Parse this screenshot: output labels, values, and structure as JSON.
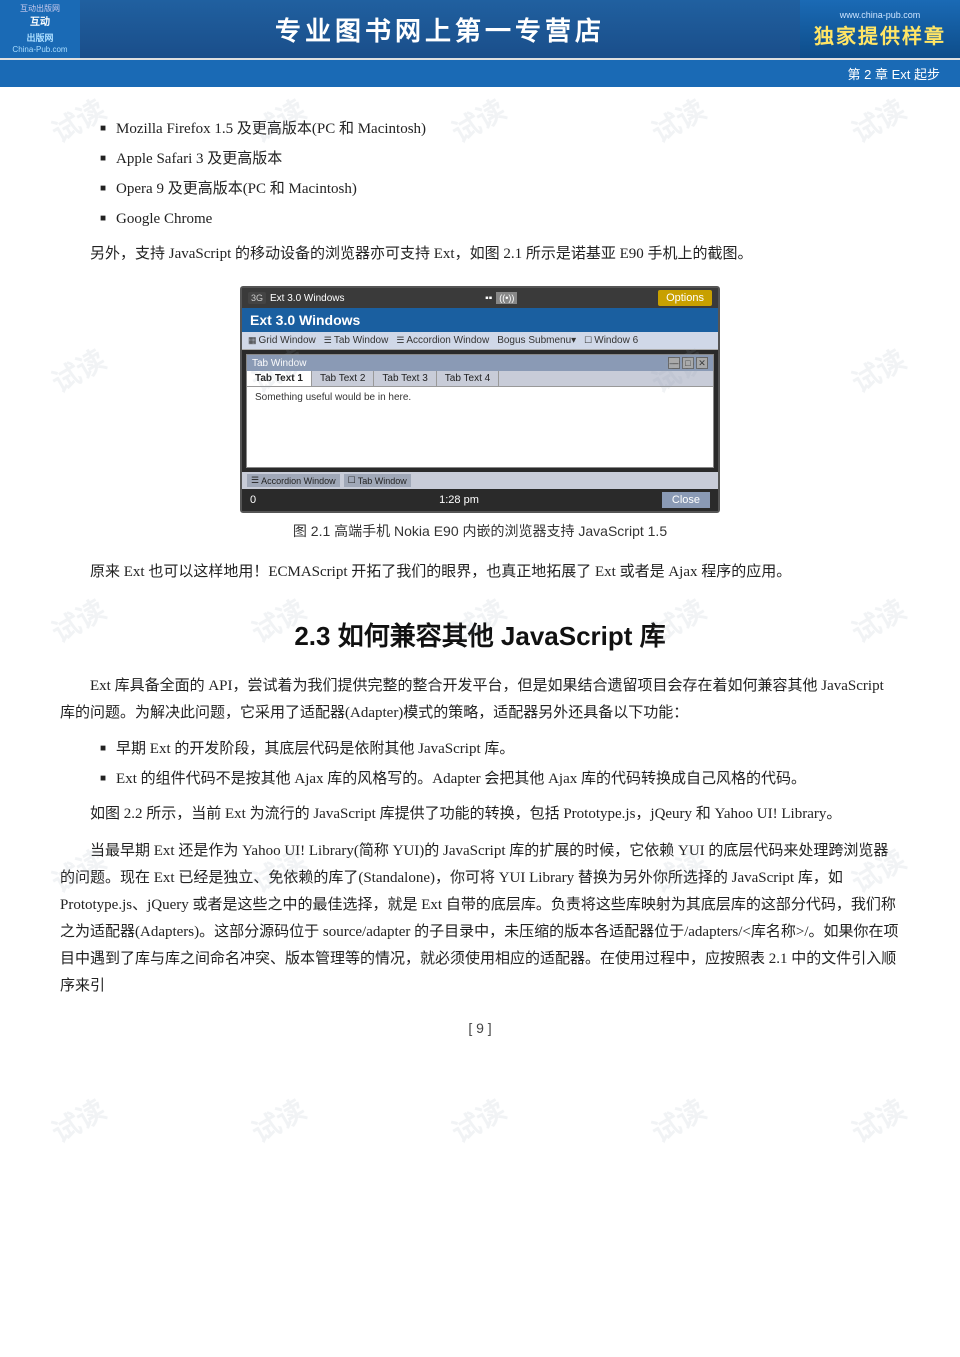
{
  "header": {
    "logo_top": "互动出版网",
    "logo_brand": "China-Pub.com",
    "logo_url": "www.china-pub.com",
    "title": "专业图书网上第一专营店",
    "badge": "独家提供样章"
  },
  "chapter_bar": {
    "text": "第 2 章    Ext 起步"
  },
  "bullet_items": [
    "Mozilla Firefox 1.5 及更高版本(PC 和 Macintosh)",
    "Apple Safari 3 及更高版本",
    "Opera 9 及更高版本(PC 和 Macintosh)",
    "Google Chrome"
  ],
  "paragraph1": "另外，支持 JavaScript 的移动设备的浏览器亦可支持 Ext，如图 2.1 所示是诺基亚 E90 手机上的截图。",
  "figure": {
    "caption": "图 2.1    高端手机 Nokia E90 内嵌的浏览器支持 JavaScript 1.5",
    "phone": {
      "status_3g": "3G",
      "app_title": "Ext 3.0 Windows",
      "options_btn": "Options",
      "subtitle": "Ext 3.0 Windows",
      "menu_items": [
        "Grid Window",
        "Tab Window",
        "Accordion Window",
        "Bogus Submenu▾",
        "Window 6"
      ],
      "window_title": "Tab Window",
      "win_controls": [
        "—",
        "□",
        "✕"
      ],
      "tabs": [
        "Tab Text 1",
        "Tab Text 2",
        "Tab Text 3",
        "Tab Text 4"
      ],
      "content": "Something useful would be in here.",
      "bottom_items": [
        "Accordion Window",
        "Tab Window"
      ],
      "status_time": "1:28 pm",
      "close_btn": "Close",
      "status_num": "0"
    }
  },
  "paragraph2": "原来 Ext 也可以这样地用！ECMAScript 开拓了我们的眼界，也真正地拓展了 Ext 或者是 Ajax 程序的应用。",
  "section_heading": "2.3    如何兼容其他 JavaScript 库",
  "paragraph3": "Ext 库具备全面的 API，尝试着为我们提供完整的整合开发平台，但是如果结合遗留项目会存在着如何兼容其他 JavaScript 库的问题。为解决此问题，它采用了适配器(Adapter)模式的策略，适配器另外还具备以下功能：",
  "bullet2_items": [
    "早期 Ext 的开发阶段，其底层代码是依附其他 JavaScript 库。",
    "Ext 的组件代码不是按其他 Ajax 库的风格写的。Adapter 会把其他 Ajax 库的代码转换成自己风格的代码。"
  ],
  "paragraph4": "如图 2.2 所示，当前 Ext 为流行的 JavaScript 库提供了功能的转换，包括 Prototype.js，jQeury 和 Yahoo UI! Library。",
  "paragraph5": "当最早期 Ext 还是作为 Yahoo UI! Library(简称 YUI)的 JavaScript 库的扩展的时候，它依赖 YUI 的底层代码来处理跨浏览器的问题。现在 Ext 已经是独立、免依赖的库了(Standalone)，你可将 YUI Library 替换为另外你所选择的 JavaScript 库，如 Prototype.js、jQuery 或者是这些之中的最佳选择，就是 Ext 自带的底层库。负责将这些库映射为其底层库的这部分代码，我们称之为适配器(Adapters)。这部分源码位于 source/adapter 的子目录中，未压缩的版本各适配器位于/adapters/<库名称>/。如果你在项目中遇到了库与库之间命名冲突、版本管理等的情况，就必须使用相应的适配器。在使用过程中，应按照表 2.1 中的文件引入顺序来引",
  "page_number": "[ 9 ]",
  "watermarks": [
    "试读",
    "试读",
    "试读",
    "试读",
    "试读",
    "试读",
    "试读",
    "试读",
    "试读",
    "试读",
    "试读",
    "试读"
  ]
}
